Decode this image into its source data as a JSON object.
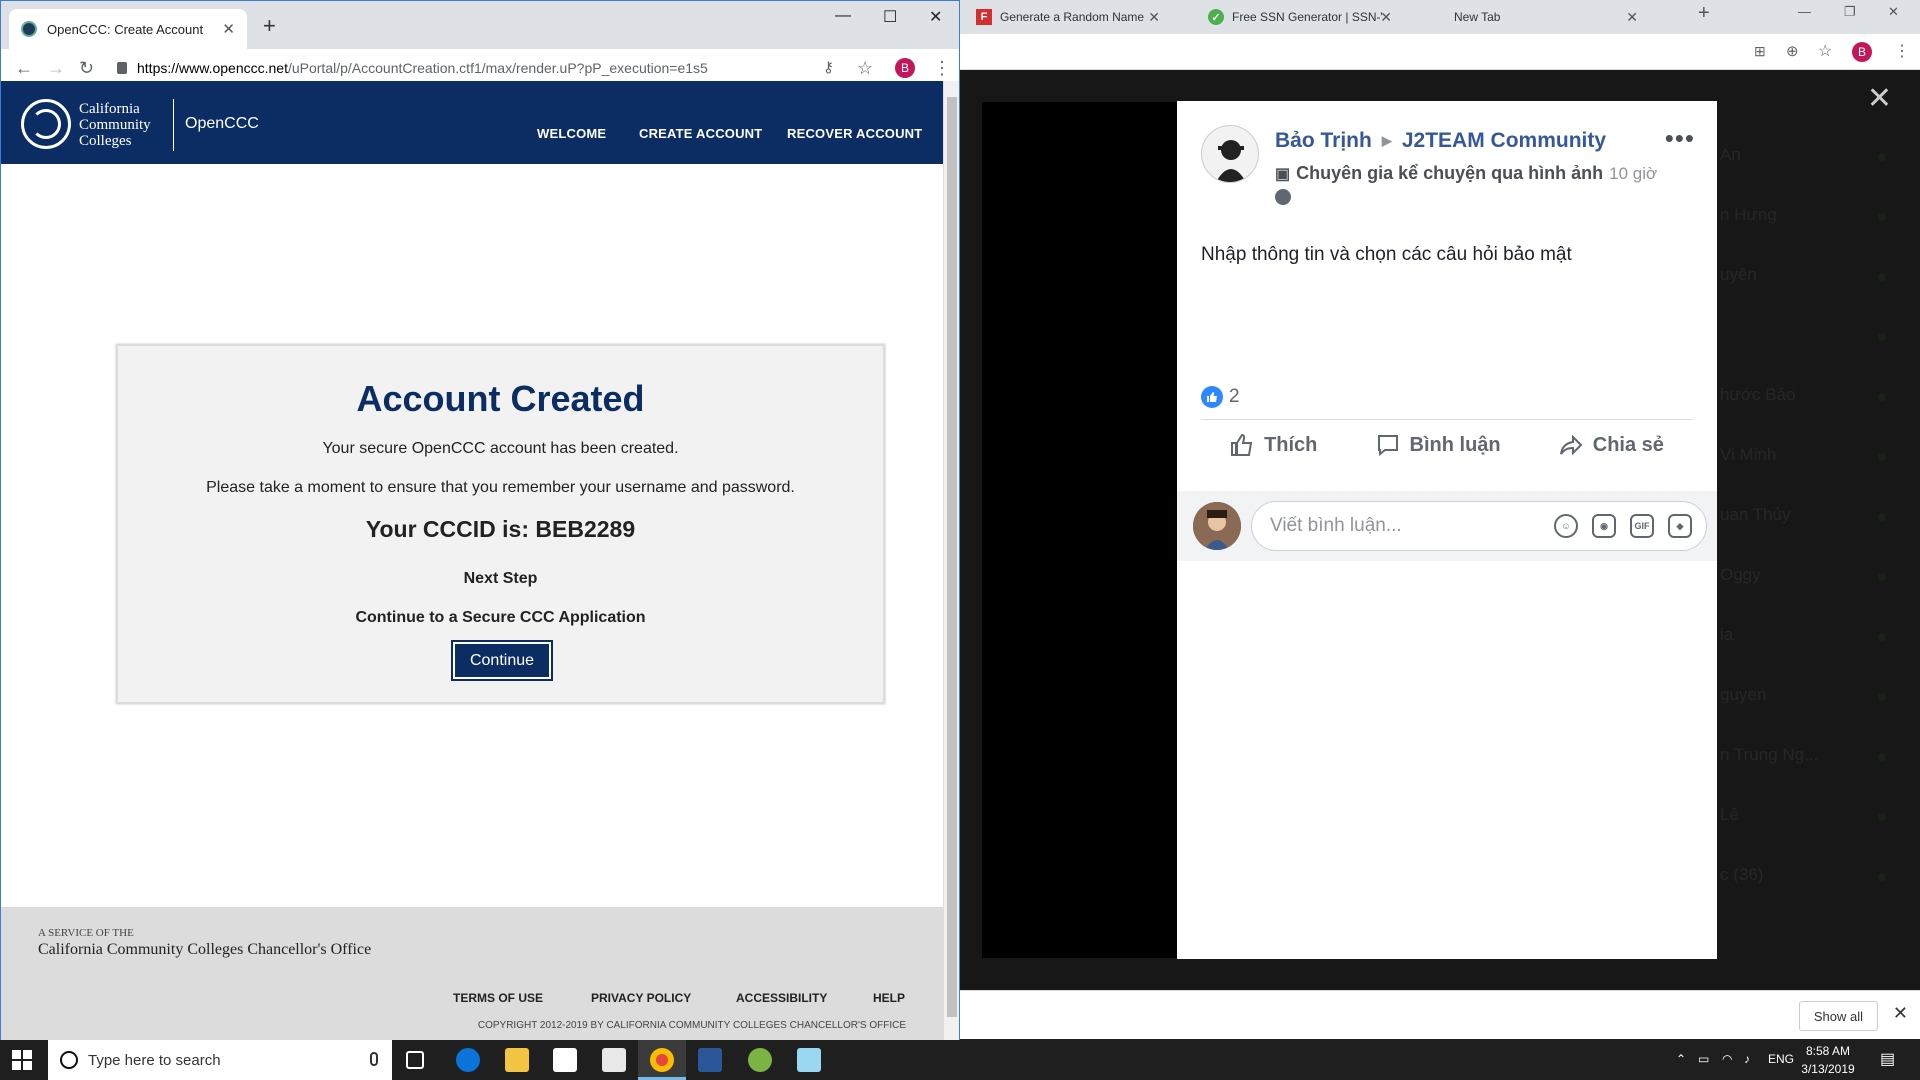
{
  "right_browser": {
    "tabs": [
      {
        "title": "Generate a Random Name - Fake",
        "favicon": "F"
      },
      {
        "title": "Free SSN Generator | SSN-Verify",
        "favicon": "check"
      },
      {
        "title": "New Tab",
        "favicon": ""
      }
    ],
    "profile_initial": "B",
    "post": {
      "author": "Bảo Trịnh",
      "group": "J2TEAM Community",
      "badge": "Chuyên gia kể chuyện qua hình ảnh",
      "time": "10 giờ",
      "text": "Nhập thông tin và chọn các câu hỏi bảo mật",
      "like_count": "2",
      "actions": {
        "like": "Thích",
        "comment": "Bình luận",
        "share": "Chia sẻ"
      },
      "comment_placeholder": "Viết bình luận...",
      "gif_label": "GIF"
    },
    "chat_list": [
      {
        "name": "An"
      },
      {
        "name": "n Hưng"
      },
      {
        "name": "uyên"
      },
      {
        "name": ""
      },
      {
        "name": "hước Bảo"
      },
      {
        "name": "Vi Minh"
      },
      {
        "name": "uan Thủy"
      },
      {
        "name": "Oggy"
      },
      {
        "name": "ia"
      },
      {
        "name": "guyen"
      },
      {
        "name": "n Trung Ng..."
      },
      {
        "name": "Lê"
      },
      {
        "name": "c (36)"
      }
    ],
    "download_bar": {
      "show_all": "Show all"
    }
  },
  "left_browser": {
    "tab_title": "OpenCCC: Create Account",
    "url_host": "https://www.openccc.net",
    "url_path": "/uPortal/p/AccountCreation.ctf1/max/render.uP?pP_execution=e1s5",
    "profile_initial": "B",
    "header": {
      "logo_line1": "California",
      "logo_line2": "Community",
      "logo_line3": "Colleges",
      "app_name": "OpenCCC",
      "nav": [
        "WELCOME",
        "CREATE ACCOUNT",
        "RECOVER ACCOUNT"
      ]
    },
    "card": {
      "title": "Account Created",
      "line1": "Your secure OpenCCC account has been created.",
      "line2": "Please take a moment to ensure that you remember your username and password.",
      "cccid": "Your CCCID is: BEB2289",
      "next_step": "Next Step",
      "continue_text": "Continue to a Secure CCC Application",
      "button": "Continue"
    },
    "footer": {
      "service_of": "A SERVICE OF THE",
      "office": "California Community Colleges Chancellor's Office",
      "links": [
        "TERMS OF USE",
        "PRIVACY POLICY",
        "ACCESSIBILITY",
        "HELP"
      ],
      "copyright": "COPYRIGHT 2012-2019 BY CALIFORNIA COMMUNITY COLLEGES CHANCELLOR'S OFFICE"
    }
  },
  "taskbar": {
    "search_placeholder": "Type here to search",
    "lang": "ENG",
    "time": "8:58 AM",
    "date": "3/13/2019"
  },
  "colors": {
    "ccc_navy": "#0b2d63",
    "fb_blue": "#365899",
    "like_blue": "#2d88ff"
  }
}
